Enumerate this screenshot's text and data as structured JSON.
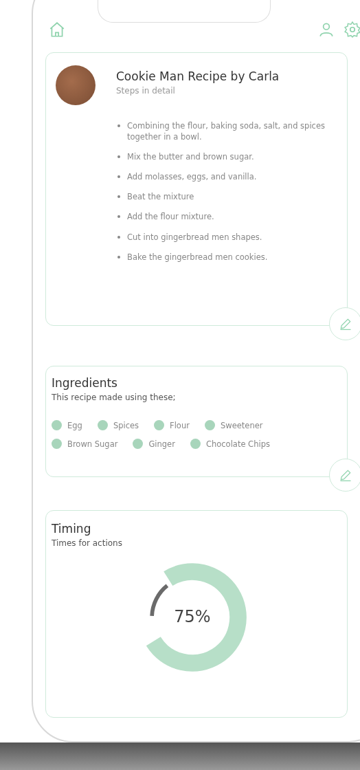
{
  "recipe": {
    "title": "Cookie Man Recipe by Carla",
    "subtitle": "Steps in detail",
    "steps": [
      "Combining the flour, baking soda, salt, and spices together in a bowl.",
      "Mix the butter and brown sugar.",
      "Add molasses, eggs, and vanilla.",
      "Beat the mixture",
      "Add the flour mixture.",
      "Cut into gingerbread men shapes.",
      "Bake the gingerbread men cookies."
    ]
  },
  "ingredients": {
    "title": "Ingredients",
    "subtitle": "This recipe made using these;",
    "items": [
      {
        "name": "Egg",
        "color": "#a8d5bb"
      },
      {
        "name": "Spices",
        "color": "#a8d5bb"
      },
      {
        "name": "Flour",
        "color": "#a8d5bb"
      },
      {
        "name": "Sweetener",
        "color": "#a8d5bb"
      },
      {
        "name": "Brown Sugar",
        "color": "#a8d5bb"
      },
      {
        "name": "Ginger",
        "color": "#a8d5bb"
      },
      {
        "name": "Chocolate Chips",
        "color": "#a8d5bb"
      }
    ]
  },
  "timing": {
    "title": "Timing",
    "subtitle": "Times for actions",
    "level": 0.75,
    "reading": "75%"
  }
}
